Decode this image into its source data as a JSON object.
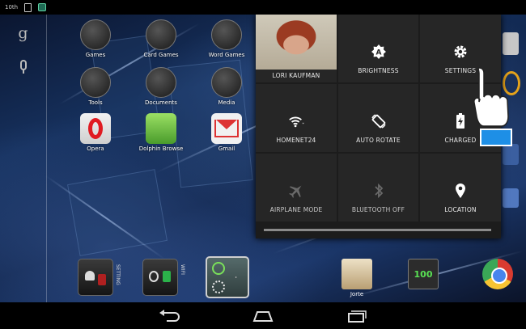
{
  "status_bar": {
    "time": "10th"
  },
  "home": {
    "apps": [
      {
        "label": "Games"
      },
      {
        "label": "Card Games"
      },
      {
        "label": "Word Games"
      },
      {
        "label": "Tools"
      },
      {
        "label": "Documents"
      },
      {
        "label": "Media"
      },
      {
        "label": "Opera"
      },
      {
        "label": "Dolphin Browse"
      },
      {
        "label": "Gmail"
      }
    ],
    "dock": {
      "widget_labels": [
        "SETTING",
        "WIFI"
      ],
      "apps": [
        {
          "label": "Jorte"
        },
        {
          "label": "100"
        }
      ]
    }
  },
  "quick_settings": {
    "user_name": "LORI KAUFMAN",
    "tiles": [
      {
        "label": "BRIGHTNESS",
        "icon": "brightness-auto-icon"
      },
      {
        "label": "SETTINGS",
        "icon": "gear-icon"
      },
      {
        "label": "HOMENET24",
        "icon": "wifi-icon"
      },
      {
        "label": "AUTO ROTATE",
        "icon": "auto-rotate-icon"
      },
      {
        "label": "CHARGED",
        "icon": "battery-charging-icon"
      },
      {
        "label": "AIRPLANE MODE",
        "icon": "airplane-icon"
      },
      {
        "label": "BLUETOOTH OFF",
        "icon": "bluetooth-icon"
      },
      {
        "label": "LOCATION",
        "icon": "location-pin-icon"
      }
    ]
  },
  "colors": {
    "panel_bg": "#1c1c1c",
    "tile_bg": "#262626",
    "accent_green": "#59e153",
    "cursor_blue": "#1e8fe6"
  }
}
